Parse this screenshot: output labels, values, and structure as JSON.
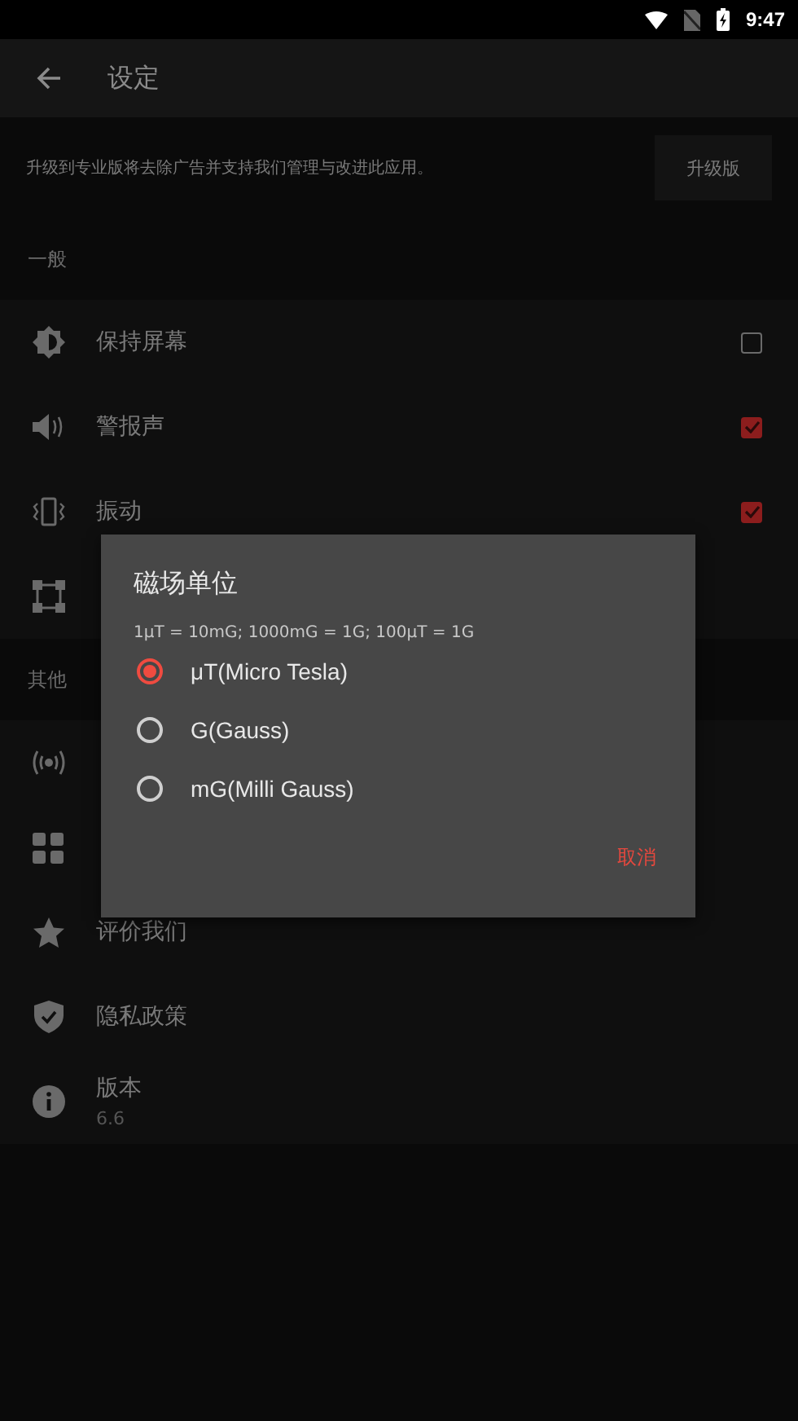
{
  "status_bar": {
    "time": "9:47"
  },
  "toolbar": {
    "title": "设定"
  },
  "upgrade": {
    "message": "升级到专业版将去除广告并支持我们管理与改进此应用。",
    "button": "升级版"
  },
  "sections": [
    {
      "header": "一般",
      "items": [
        {
          "kind": "checkbox",
          "label": "保持屏幕",
          "checked": false
        },
        {
          "kind": "checkbox",
          "label": "警报声",
          "checked": true
        },
        {
          "kind": "checkbox",
          "label": "振动",
          "checked": true
        },
        {
          "kind": "plain"
        }
      ]
    },
    {
      "header": "其他",
      "items": [
        {
          "kind": "plain"
        },
        {
          "kind": "plain"
        },
        {
          "kind": "plain",
          "label": "评价我们"
        },
        {
          "kind": "plain",
          "label": "隐私政策"
        },
        {
          "kind": "plain",
          "label": "版本",
          "subtitle": "6.6"
        }
      ]
    }
  ],
  "dialog": {
    "title": "磁场单位",
    "note": "1μT = 10mG; 1000mG = 1G; 100μT = 1G",
    "options": [
      {
        "label": "μT(Micro Tesla)",
        "selected": true
      },
      {
        "label": "G(Gauss)",
        "selected": false
      },
      {
        "label": "mG(Milli Gauss)",
        "selected": false
      }
    ],
    "cancel": "取消"
  }
}
